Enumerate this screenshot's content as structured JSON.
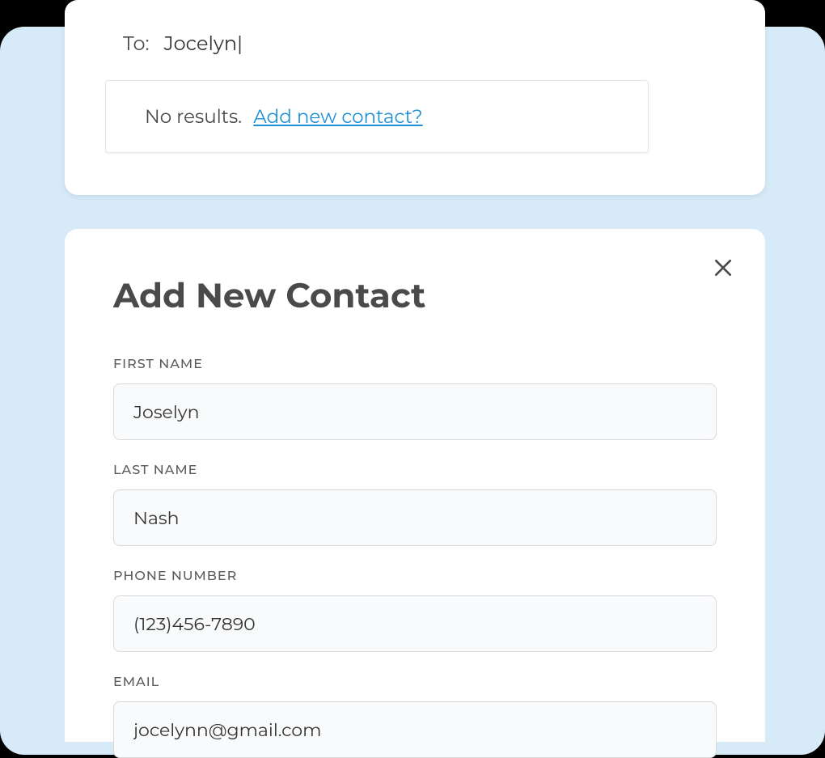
{
  "search": {
    "to_label": "To:",
    "to_value": "Jocelyn",
    "no_results": "No results.",
    "add_link": "Add new contact?"
  },
  "form": {
    "title": "Add New Contact",
    "fields": {
      "first_name": {
        "label": "FIRST NAME",
        "value": "Joselyn"
      },
      "last_name": {
        "label": "LAST NAME",
        "value": "Nash"
      },
      "phone": {
        "label": "PHONE NUMBER",
        "value": "(123)456-7890"
      },
      "email": {
        "label": "EMAIL",
        "value": "jocelynn@gmail.com"
      }
    }
  }
}
